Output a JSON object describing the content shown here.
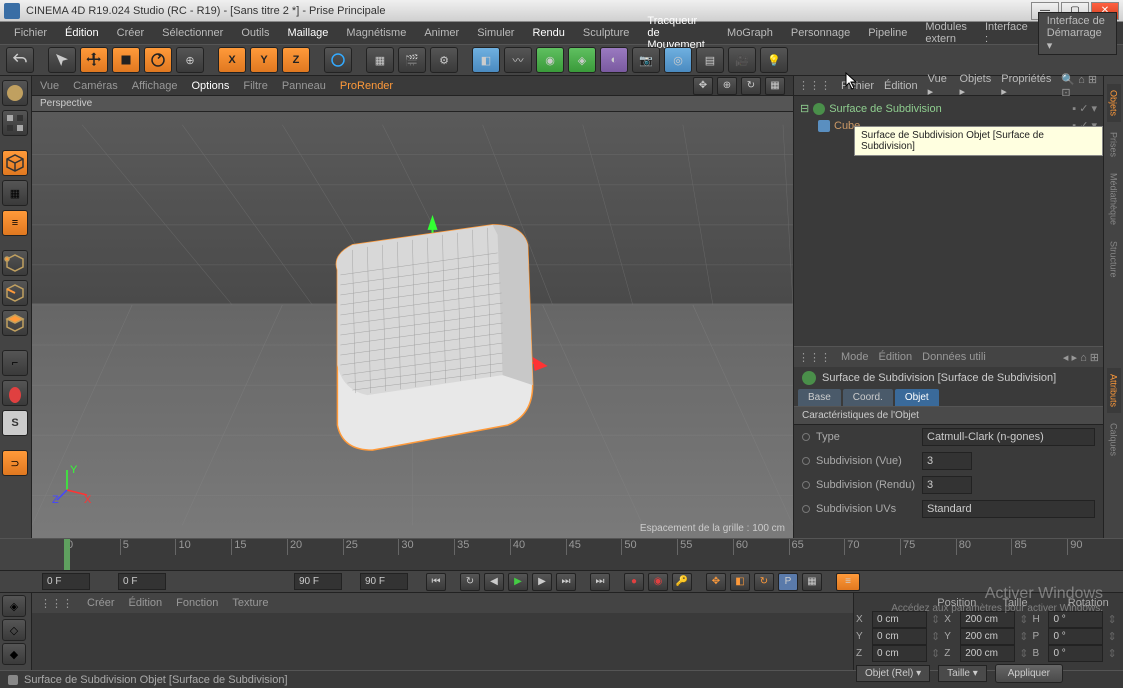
{
  "title": "CINEMA 4D R19.024 Studio (RC - R19) - [Sans titre 2 *] - Prise Principale",
  "menu": {
    "fichier": "Fichier",
    "edition": "Édition",
    "creer": "Créer",
    "selectionner": "Sélectionner",
    "outils": "Outils",
    "maillage": "Maillage",
    "magnetisme": "Magnétisme",
    "animer": "Animer",
    "simuler": "Simuler",
    "rendu": "Rendu",
    "sculpture": "Sculpture",
    "tracqueur": "Tracqueur de Mouvement",
    "mograph": "MoGraph",
    "personnage": "Personnage",
    "pipeline": "Pipeline",
    "modules": "Modules extern",
    "interface": "Interface :"
  },
  "layout": "Interface de Démarrage ▾",
  "vpmenu": {
    "vue": "Vue",
    "cameras": "Caméras",
    "affichage": "Affichage",
    "options": "Options",
    "filtre": "Filtre",
    "panneau": "Panneau",
    "prorender": "ProRender"
  },
  "viewlabel": "Perspective",
  "gridinfo": "Espacement de la grille : 100 cm",
  "rpbar": {
    "fichier": "Fichier",
    "edition": "Édition",
    "vue": "Vue ▸",
    "objets": "Objets ▸",
    "props": "Propriétés ▸"
  },
  "tree": {
    "item1": "Surface de Subdivision",
    "item2": "Cube"
  },
  "tooltip": "Surface de Subdivision Objet [Surface de Subdivision]",
  "attrbar": {
    "mode": "Mode",
    "edition": "Édition",
    "donnees": "Données utili"
  },
  "attrtitle": "Surface de Subdivision [Surface de Subdivision]",
  "attrtabs": {
    "base": "Base",
    "coord": "Coord.",
    "objet": "Objet"
  },
  "attrsection": "Caractéristiques de l'Objet",
  "attrs": {
    "type_lbl": "Type",
    "type_val": "Catmull-Clark (n-gones)",
    "subvue_lbl": "Subdivision (Vue)",
    "subvue_val": "3",
    "subrendu_lbl": "Subdivision (Rendu)",
    "subrendu_val": "3",
    "subuvs_lbl": "Subdivision UVs",
    "subuvs_val": "Standard"
  },
  "timeline": {
    "marks": [
      "0",
      "5",
      "10",
      "15",
      "20",
      "25",
      "30",
      "35",
      "40",
      "45",
      "50",
      "55",
      "60",
      "65",
      "70",
      "75",
      "80",
      "85",
      "90"
    ]
  },
  "play": {
    "f1": "0 F",
    "f2": "0 F",
    "f3": "90 F",
    "f4": "90 F"
  },
  "matbar": {
    "creer": "Créer",
    "edition": "Édition",
    "fonction": "Fonction",
    "texture": "Texture"
  },
  "coord": {
    "hdr_pos": "Position",
    "hdr_taille": "Taille",
    "hdr_rot": "Rotation",
    "x": "X",
    "y": "Y",
    "z": "Z",
    "px": "0 cm",
    "py": "0 cm",
    "pz": "0 cm",
    "tx": "200 cm",
    "ty": "200 cm",
    "tz": "200 cm",
    "rh": "H",
    "rp": "P",
    "rb": "B",
    "rhv": "0 °",
    "rpv": "0 °",
    "rbv": "0 °",
    "selobj": "Objet (Rel)   ▾",
    "seltaille": "Taille            ▾",
    "apply": "Appliquer"
  },
  "status": "Surface de Subdivision Objet [Surface de Subdivision]",
  "rtabs": {
    "objets": "Objets",
    "prises": "Prises",
    "media": "Médiathèque",
    "struct": "Structure",
    "attrib": "Attributs",
    "calques": "Calques"
  },
  "winact": {
    "l1": "Activer Windows",
    "l2": "Accédez aux paramètres pour activer Windows."
  }
}
